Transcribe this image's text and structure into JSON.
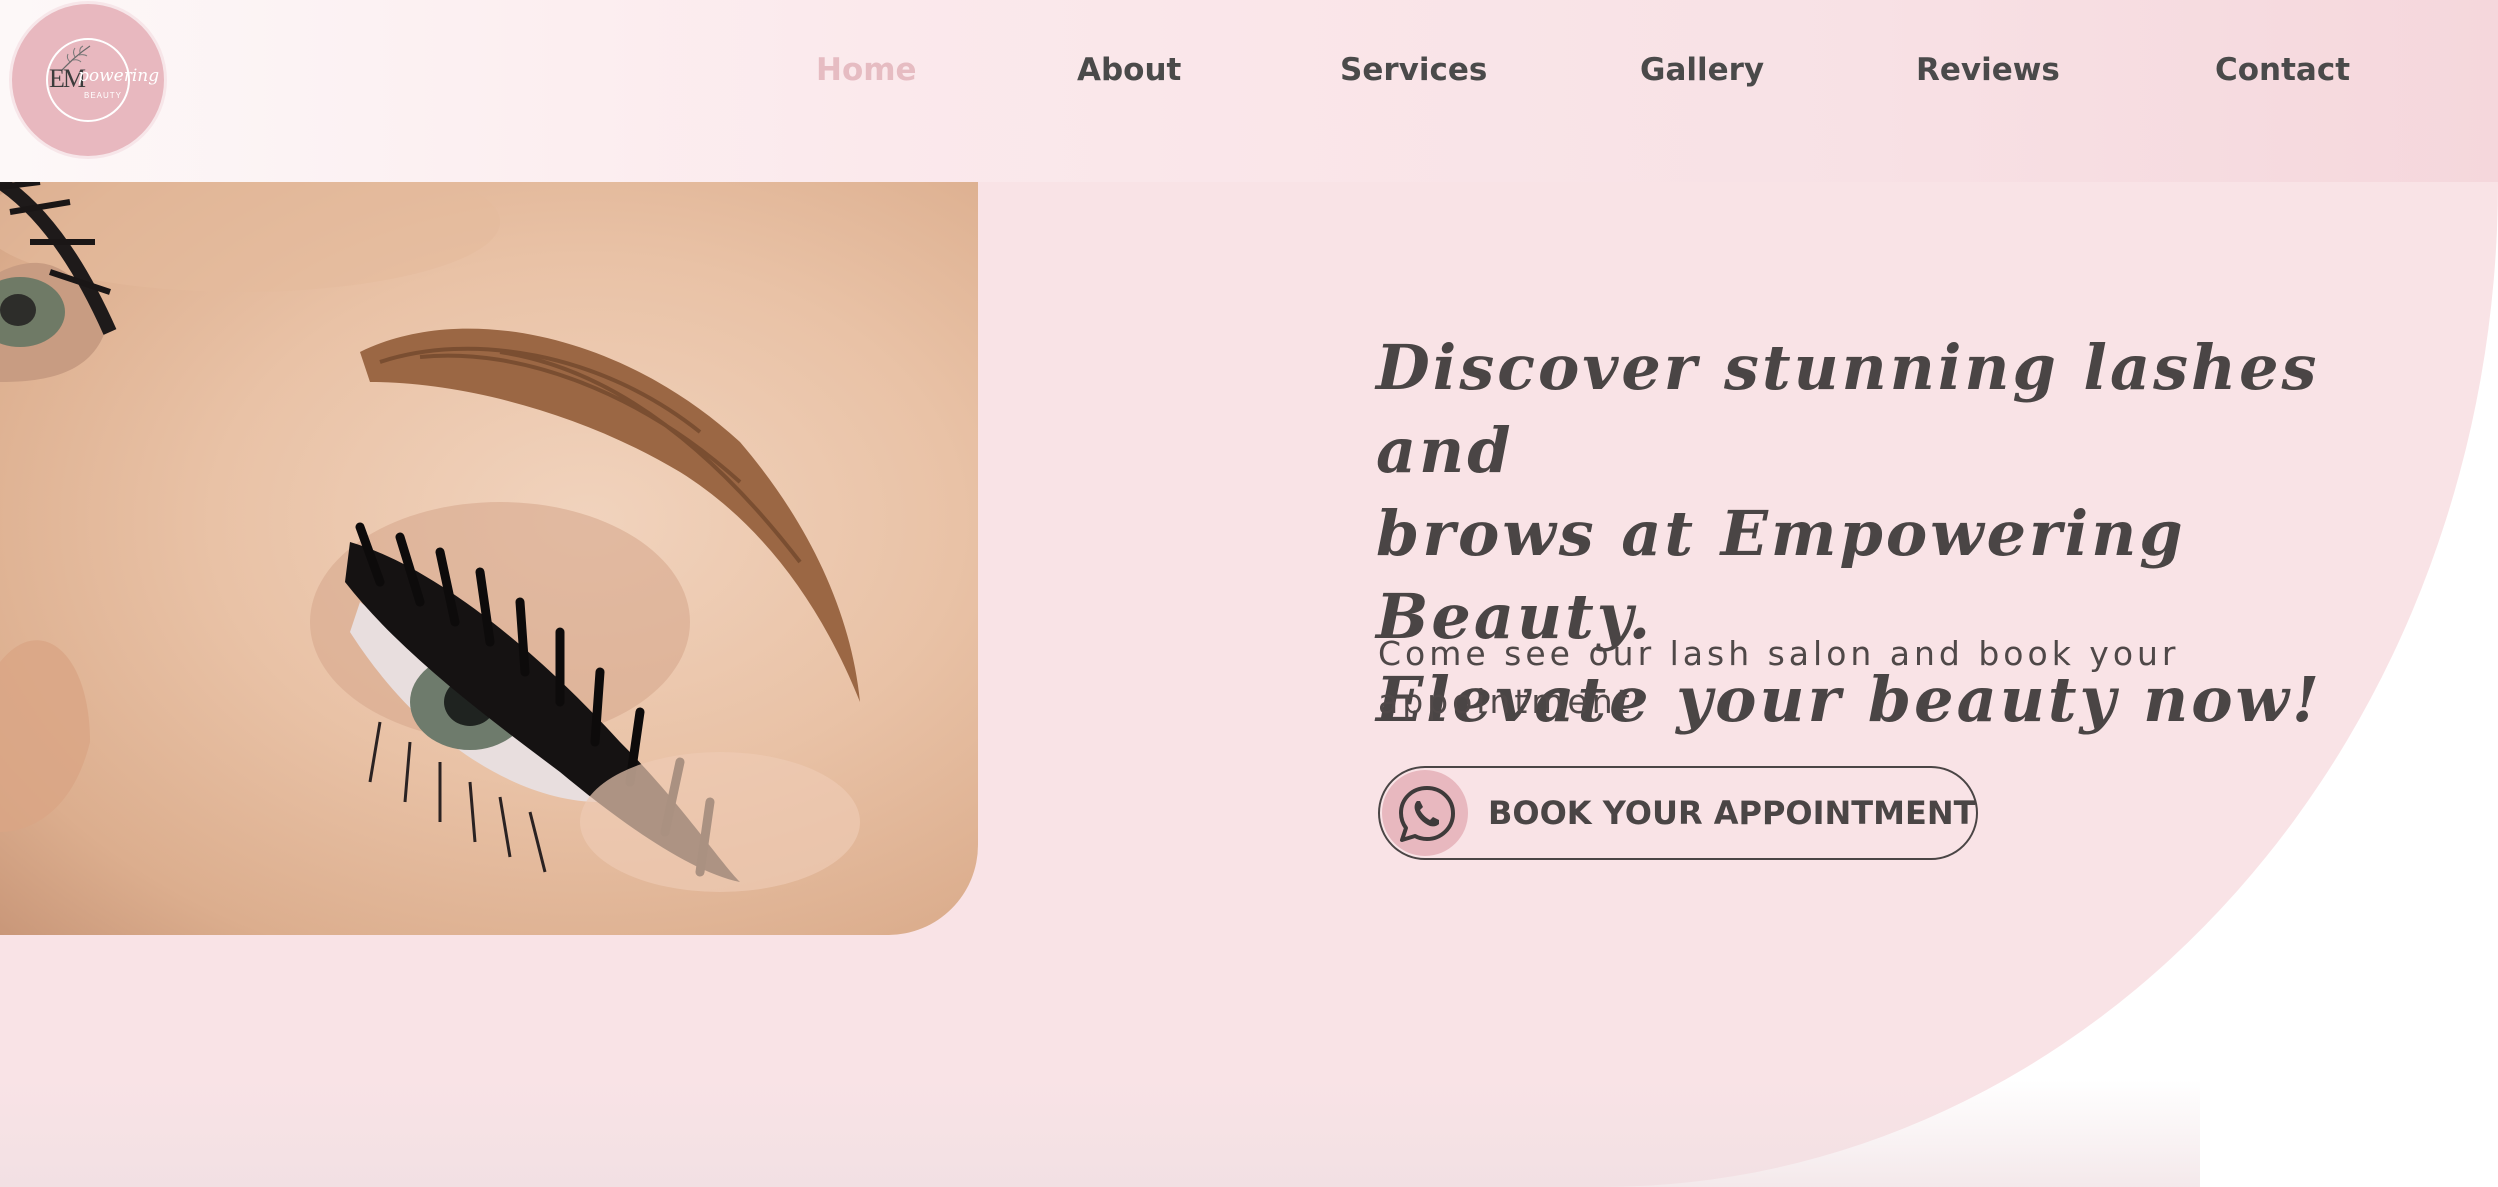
{
  "header": {
    "logo": {
      "monogram": "EM",
      "script": "powering",
      "tagline": "BEAUTY"
    },
    "nav": [
      {
        "label": "Home",
        "active": true
      },
      {
        "label": "About",
        "active": false
      },
      {
        "label": "Services",
        "active": false
      },
      {
        "label": "Gallery",
        "active": false
      },
      {
        "label": "Reviews",
        "active": false
      },
      {
        "label": "Contact",
        "active": false
      }
    ]
  },
  "hero": {
    "headline_lines": [
      "Discover stunning lashes and",
      "brows at Empowering Beauty.",
      "Elevate your beauty now!"
    ],
    "subline_lines": [
      "Come see our lash salon and book your",
      "appointment"
    ],
    "cta": {
      "label": "BOOK YOUR APPOINTMENT",
      "icon": "whatsapp-icon"
    },
    "image": "eye-lash-extension-photo"
  },
  "colors": {
    "accent_pink": "#e8b8bf",
    "nav_active": "#e6bcc2",
    "hero_background": "#f9e3e6",
    "text_dark": "#4a4545"
  }
}
